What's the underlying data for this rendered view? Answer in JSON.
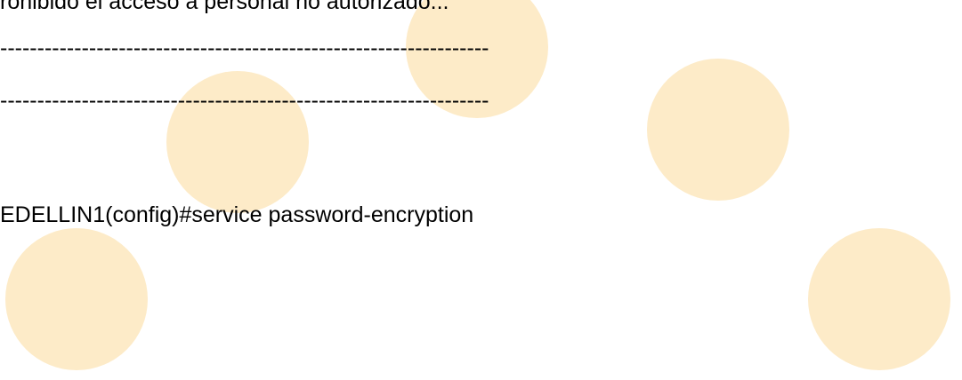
{
  "document": {
    "lines": [
      "rohibido el acceso a personal no autorizado...",
      "------------------------------------------------------------------",
      "------------------------------------------------------------------",
      "EDELLIN1(config)#service password-encryption"
    ]
  },
  "colors": {
    "background": "#ffffff",
    "text": "#000000",
    "decorative_circle": "#fdebc8"
  }
}
